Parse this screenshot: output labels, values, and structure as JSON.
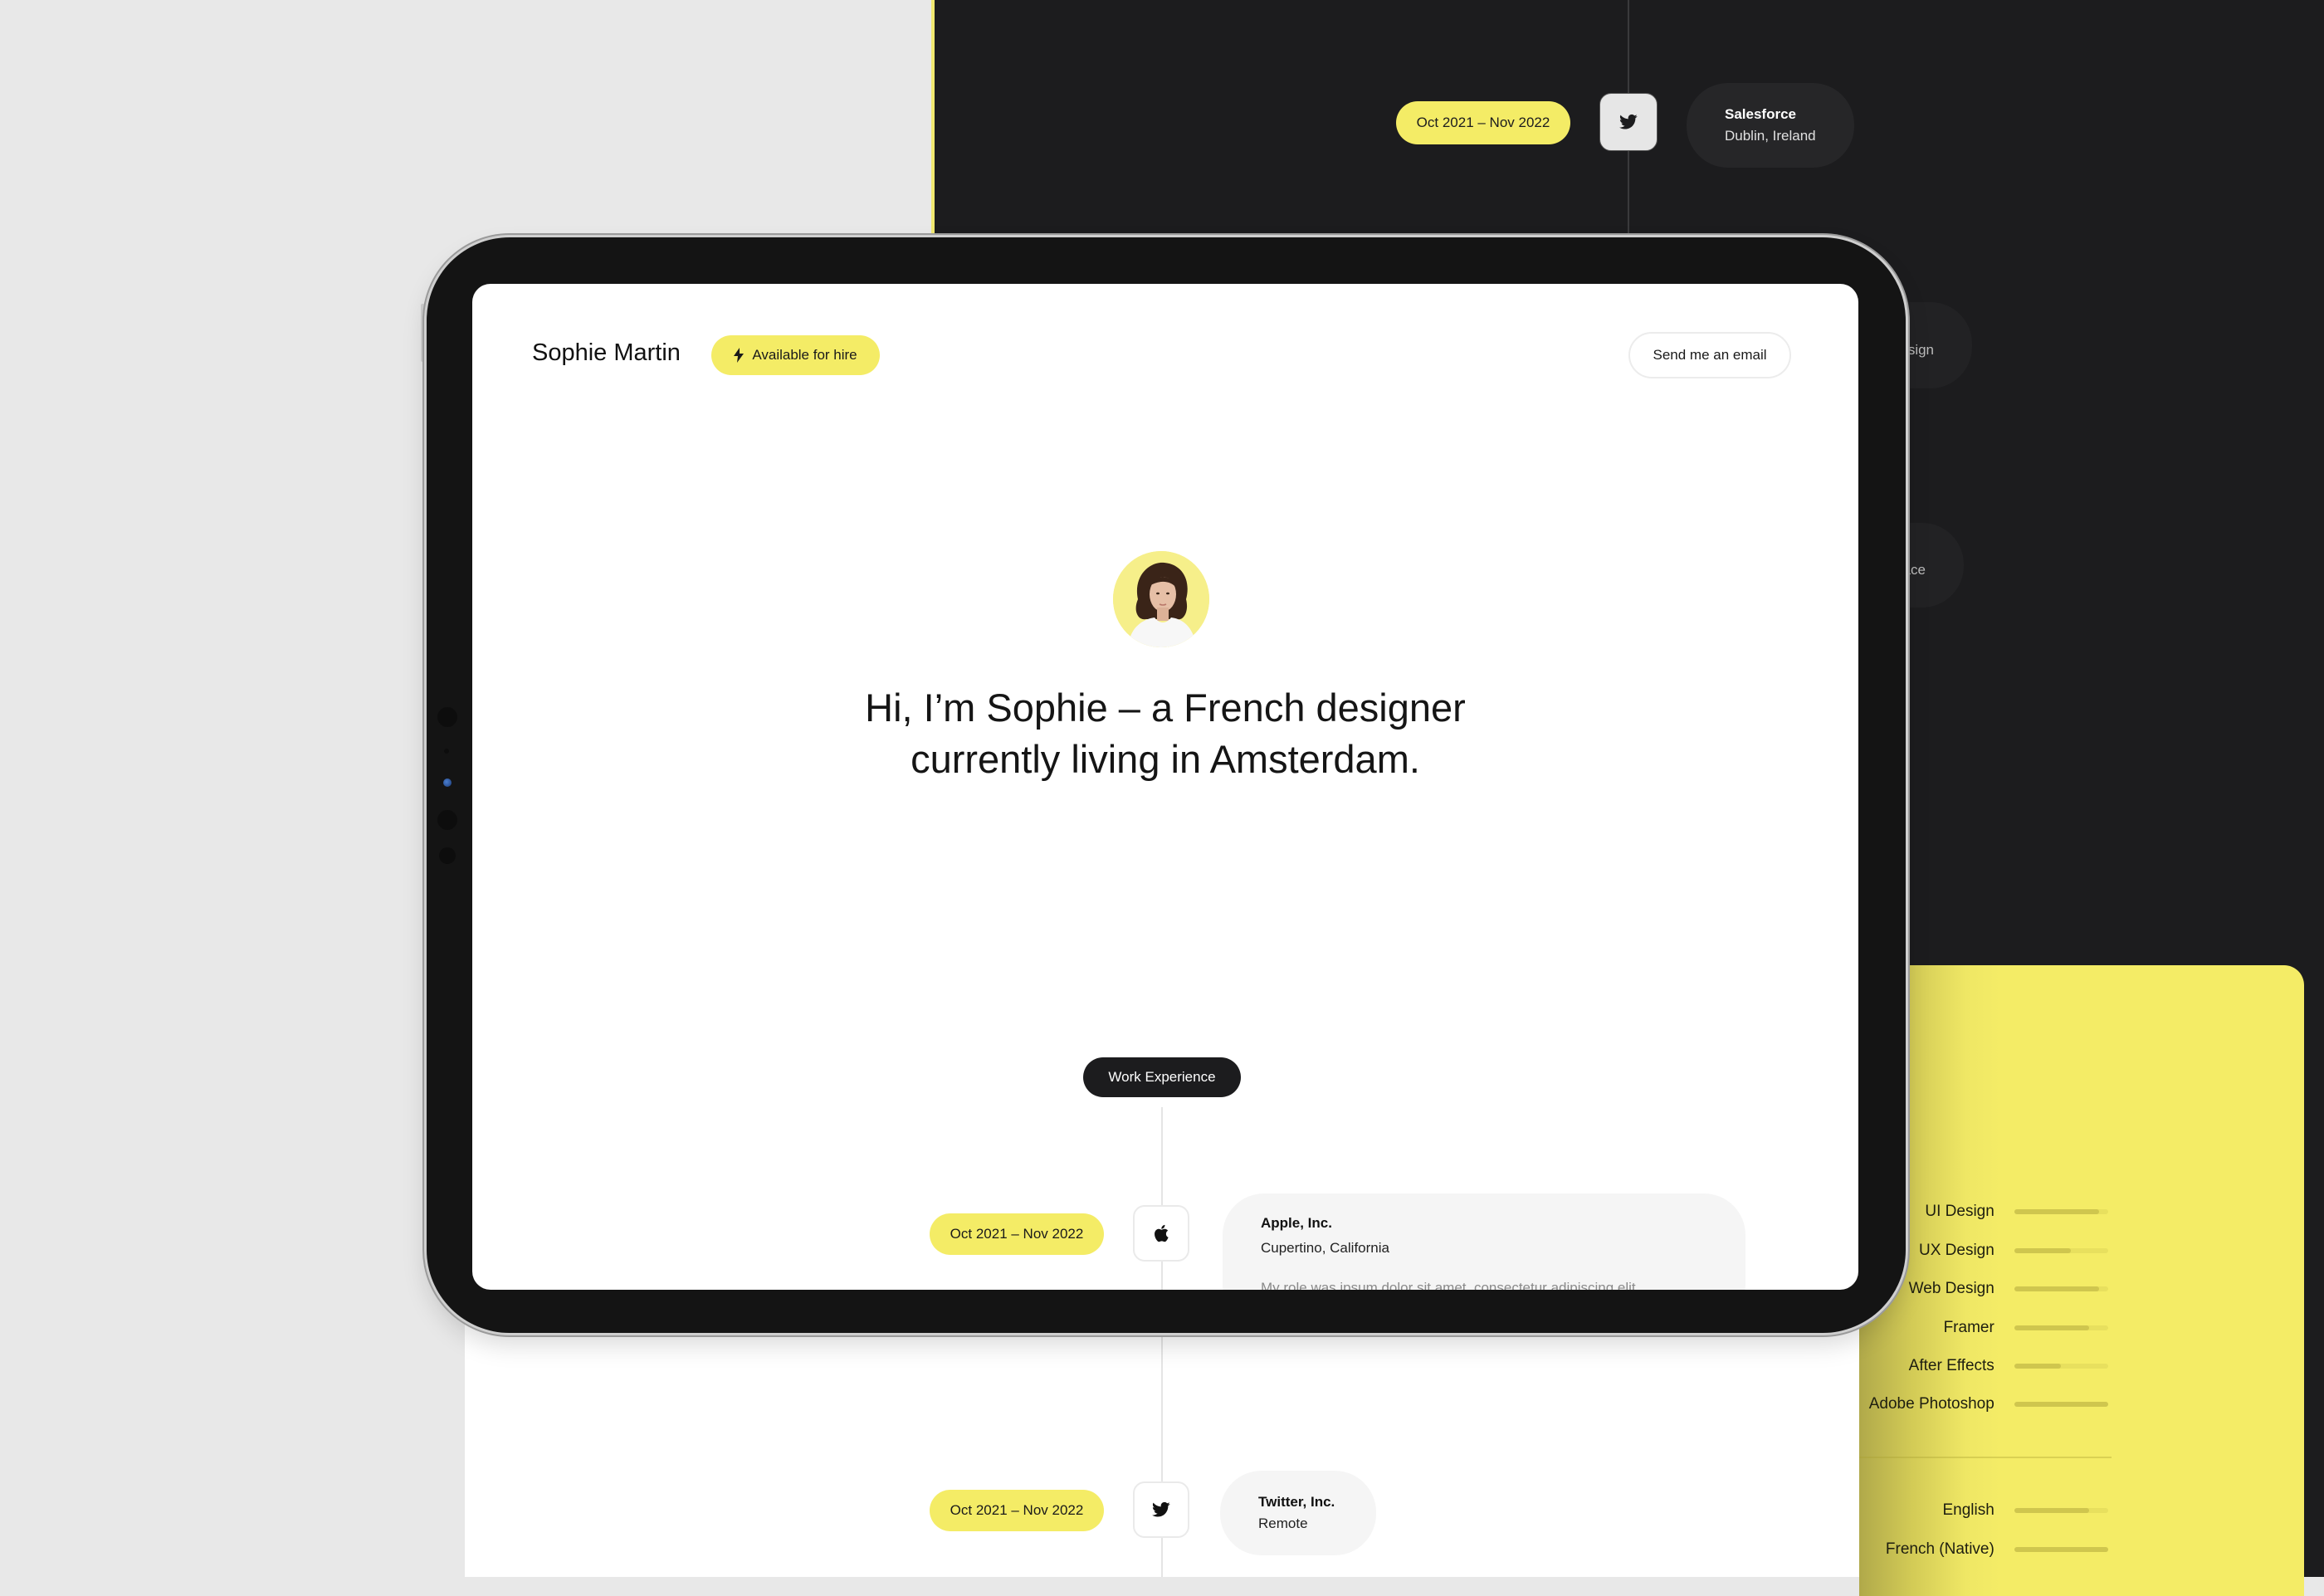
{
  "portfolio": {
    "owner_name": "Sophie Martin",
    "availability_badge": "Available for hire",
    "email_button": "Send me an email",
    "headline_line1": "Hi, I’m Sophie – a French designer",
    "headline_line2": "currently living in Amsterdam.",
    "section_label": "Work Experience",
    "accent_color": "#f4ec66",
    "dark_color": "#1c1c1e"
  },
  "experience": [
    {
      "date_range": "Oct 2021 – Nov 2022",
      "icon": "apple-icon",
      "company": "Apple, Inc.",
      "location": "Cupertino, California",
      "description": "My role was ipsum dolor sit amet, consectetur adipiscing elit."
    },
    {
      "date_range": "Oct 2021 – Nov 2022",
      "icon": "twitter-icon",
      "company": "Twitter, Inc.",
      "location": "Remote"
    }
  ],
  "dark_preview": {
    "date_range": "Oct 2021 – Nov 2022",
    "icon": "twitter-icon",
    "company": "Salesforce",
    "location": "Dublin, Ireland",
    "partial_card_1": "sign",
    "partial_card_2": "ace"
  },
  "skills": [
    {
      "label": "UI Design",
      "level": 0.9
    },
    {
      "label": "UX Design",
      "level": 0.6
    },
    {
      "label": "Web Design",
      "level": 0.9
    },
    {
      "label": "Framer",
      "level": 0.8
    },
    {
      "label": "After Effects",
      "level": 0.5
    },
    {
      "label": "Adobe Photoshop",
      "level": 1.0
    }
  ],
  "languages": [
    {
      "label": "English",
      "level": 0.8
    },
    {
      "label": "French (Native)",
      "level": 1.0
    }
  ]
}
